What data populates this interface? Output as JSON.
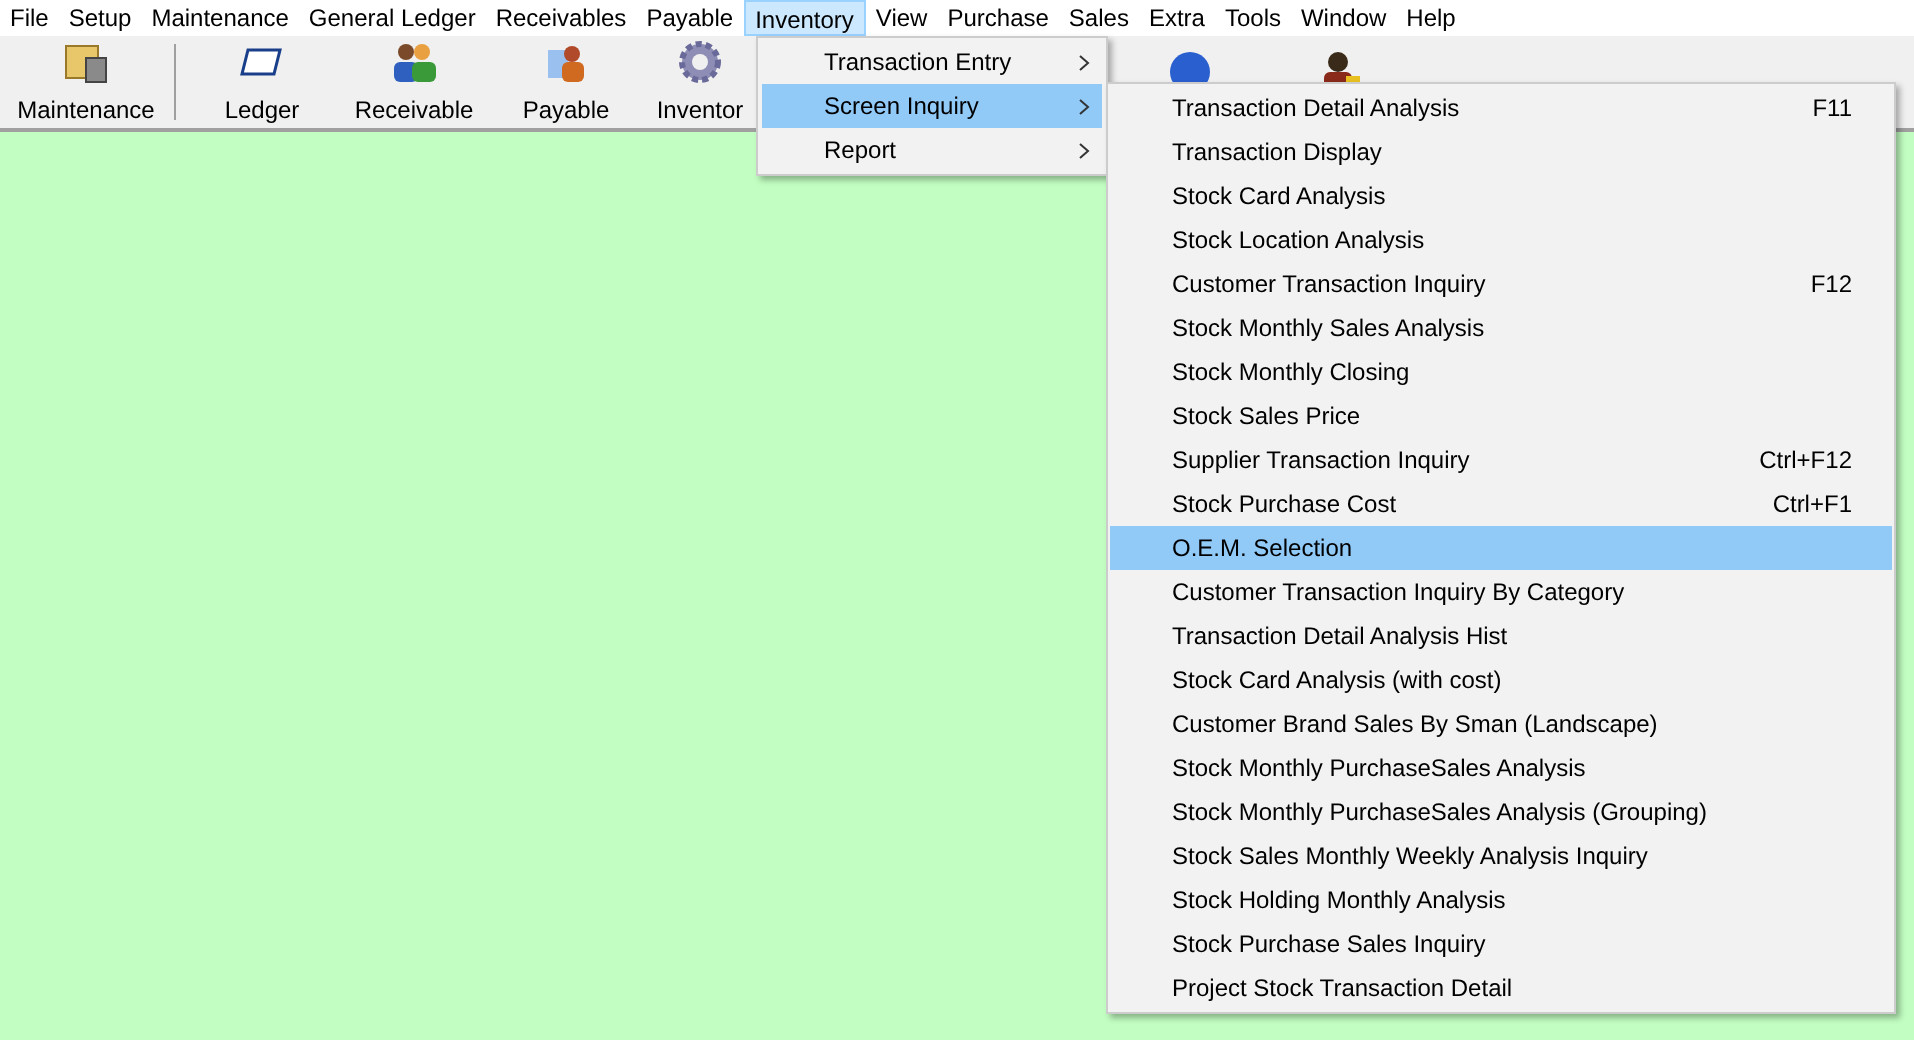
{
  "menu_bar": [
    {
      "label": "File",
      "selected": false
    },
    {
      "label": "Setup",
      "selected": false
    },
    {
      "label": "Maintenance",
      "selected": false
    },
    {
      "label": "General Ledger",
      "selected": false
    },
    {
      "label": "Receivables",
      "selected": false
    },
    {
      "label": "Payable",
      "selected": false
    },
    {
      "label": "Inventory",
      "selected": true
    },
    {
      "label": "View",
      "selected": false
    },
    {
      "label": "Purchase",
      "selected": false
    },
    {
      "label": "Sales",
      "selected": false
    },
    {
      "label": "Extra",
      "selected": false
    },
    {
      "label": "Tools",
      "selected": false
    },
    {
      "label": "Window",
      "selected": false
    },
    {
      "label": "Help",
      "selected": false
    }
  ],
  "toolbar": [
    {
      "kind": "folder",
      "label": "Maintenance"
    },
    {
      "kind": "ledger",
      "label": "Ledger"
    },
    {
      "kind": "people",
      "label": "Receivable"
    },
    {
      "kind": "payable",
      "label": "Payable"
    },
    {
      "kind": "gear",
      "label": "Inventor"
    },
    {
      "kind": "help"
    },
    {
      "kind": "person"
    }
  ],
  "inventory_menu": [
    {
      "label": "Transaction Entry",
      "selected": false
    },
    {
      "label": "Screen Inquiry",
      "selected": true
    },
    {
      "label": "Report",
      "selected": false
    }
  ],
  "screen_inquiry_menu": [
    {
      "label": "Transaction Detail Analysis",
      "shortcut": "F11",
      "selected": false
    },
    {
      "label": "Transaction Display",
      "selected": false
    },
    {
      "label": "Stock Card Analysis",
      "selected": false
    },
    {
      "label": "Stock Location Analysis",
      "selected": false
    },
    {
      "label": "Customer Transaction Inquiry",
      "shortcut": "F12",
      "selected": false
    },
    {
      "label": "Stock Monthly Sales Analysis",
      "selected": false
    },
    {
      "label": "Stock Monthly Closing",
      "selected": false
    },
    {
      "label": "Stock Sales Price",
      "selected": false
    },
    {
      "label": "Supplier Transaction Inquiry",
      "shortcut": "Ctrl+F12",
      "selected": false
    },
    {
      "label": "Stock Purchase Cost",
      "shortcut": "Ctrl+F1",
      "selected": false
    },
    {
      "label": "O.E.M. Selection",
      "selected": true
    },
    {
      "label": "Customer Transaction Inquiry By Category",
      "selected": false
    },
    {
      "label": "Transaction Detail Analysis Hist",
      "selected": false
    },
    {
      "label": "Stock Card Analysis (with cost)",
      "selected": false
    },
    {
      "label": "Customer Brand Sales By Sman (Landscape)",
      "selected": false
    },
    {
      "label": "Stock Monthly PurchaseSales Analysis",
      "selected": false
    },
    {
      "label": "Stock Monthly PurchaseSales Analysis (Grouping)",
      "selected": false
    },
    {
      "label": "Stock Sales Monthly Weekly Analysis Inquiry",
      "selected": false
    },
    {
      "label": "Stock Holding Monthly Analysis",
      "selected": false
    },
    {
      "label": "Stock Purchase Sales Inquiry",
      "selected": false
    },
    {
      "label": "Project Stock Transaction Detail",
      "selected": false
    }
  ]
}
